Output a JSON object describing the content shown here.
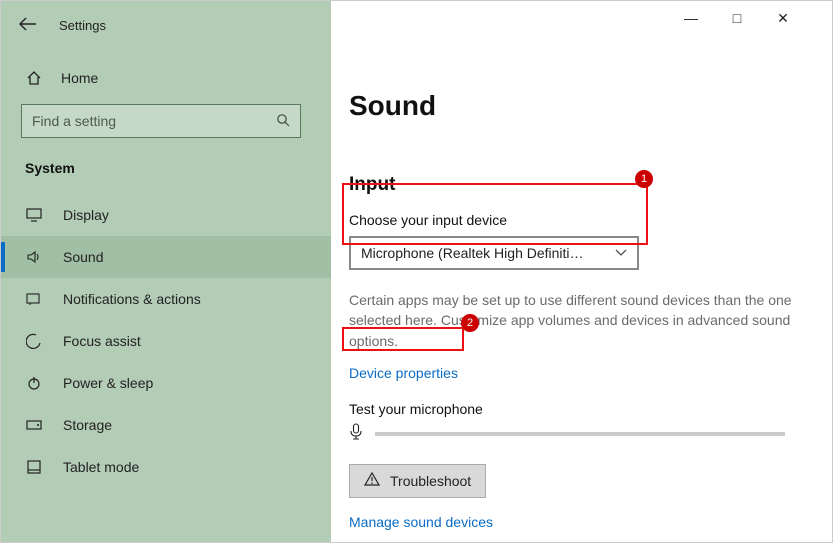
{
  "window": {
    "app_label": "Settings",
    "minimize": "—",
    "maximize": "□",
    "close": "✕"
  },
  "sidebar": {
    "home": "Home",
    "search_placeholder": "Find a setting",
    "category": "System",
    "items": [
      {
        "icon": "display",
        "label": "Display"
      },
      {
        "icon": "sound",
        "label": "Sound"
      },
      {
        "icon": "notifications",
        "label": "Notifications & actions"
      },
      {
        "icon": "focus",
        "label": "Focus assist"
      },
      {
        "icon": "power",
        "label": "Power & sleep"
      },
      {
        "icon": "storage",
        "label": "Storage"
      },
      {
        "icon": "tablet",
        "label": "Tablet mode"
      }
    ]
  },
  "main": {
    "title": "Sound",
    "section": "Input",
    "choose_label": "Choose your input device",
    "dropdown_value": "Microphone (Realtek High Definiti…",
    "help": "Certain apps may be set up to use different sound devices than the one selected here. Customize app volumes and devices in advanced sound options.",
    "device_props": "Device properties",
    "test_label": "Test your microphone",
    "troubleshoot": "Troubleshoot",
    "manage": "Manage sound devices"
  },
  "annotations": {
    "badge1": "1",
    "badge2": "2"
  }
}
